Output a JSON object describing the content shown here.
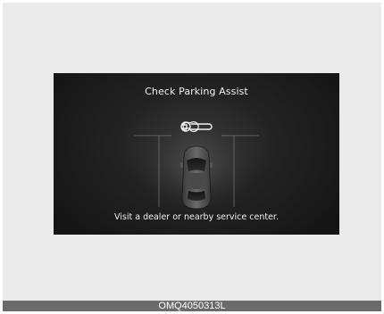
{
  "display": {
    "title": "Check Parking Assist",
    "message": "Visit a dealer or nearby service center.",
    "icons": [
      "wrench-icon",
      "car-icon"
    ]
  },
  "footer": {
    "caption": "OMQ4050313L"
  },
  "colors": {
    "frame_background": "#eaeaea",
    "screen_background": "#1a1a1a",
    "text": "#f2f2f2",
    "caption_bar": "#6b6b6b"
  }
}
